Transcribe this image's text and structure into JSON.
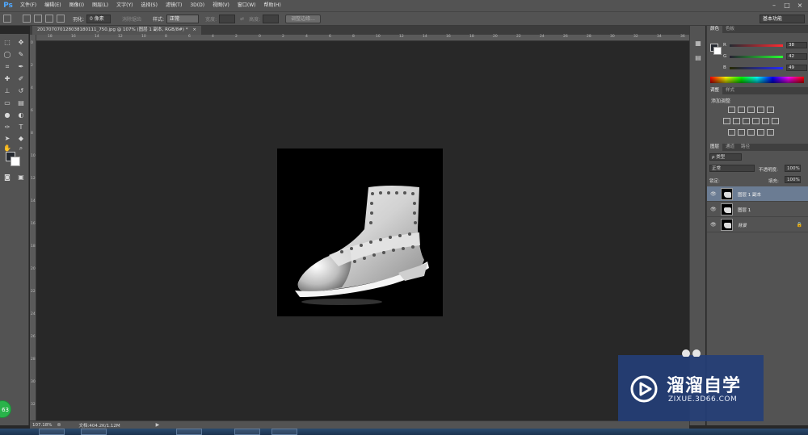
{
  "app": {
    "logo": "Ps",
    "menu": [
      "文件(F)",
      "编辑(E)",
      "图像(I)",
      "图层(L)",
      "文字(Y)",
      "选择(S)",
      "滤镜(T)",
      "3D(D)",
      "视图(V)",
      "窗口(W)",
      "帮助(H)"
    ],
    "window_buttons": [
      "–",
      "□",
      "×"
    ]
  },
  "options_bar": {
    "feather_label": "羽化:",
    "feather_value": "0 像素",
    "antialias_label": "消除锯齿",
    "style_label": "样式:",
    "style_value": "正常",
    "width_label": "宽度:",
    "height_label": "高度:",
    "refine_edge_button": "调整边缘...",
    "workspace": "基本功能"
  },
  "document": {
    "tab_title": "201707070128038180111_750.jpg @ 107% (图层 1 副本, RGB/8#) *",
    "close_icon": "×"
  },
  "rulers": {
    "top_ticks": [
      "18",
      "16",
      "14",
      "12",
      "10",
      "8",
      "6",
      "4",
      "2",
      "0",
      "2",
      "4",
      "6",
      "8",
      "10",
      "12",
      "14",
      "16",
      "18",
      "20",
      "22",
      "24",
      "26",
      "28",
      "30",
      "32",
      "34",
      "36"
    ],
    "left_ticks": [
      "0",
      "2",
      "4",
      "6",
      "8",
      "10",
      "12",
      "14",
      "16",
      "18",
      "20",
      "22",
      "24",
      "26",
      "28",
      "30",
      "32"
    ]
  },
  "status_bar": {
    "zoom": "107.18%",
    "doc_size": "文档:404.2K/1.12M"
  },
  "color_panel": {
    "tabs": [
      "颜色",
      "色板"
    ],
    "channels": [
      {
        "name": "R",
        "value": "38",
        "color": "#ff3030"
      },
      {
        "name": "G",
        "value": "42",
        "color": "#30c030"
      },
      {
        "name": "B",
        "value": "49",
        "color": "#3050ff"
      }
    ]
  },
  "adjustments_panel": {
    "tabs": [
      "调整",
      "样式"
    ],
    "heading": "添加调整"
  },
  "layers_panel": {
    "tabs": [
      "图层",
      "通道",
      "路径"
    ],
    "kind_filter": "ρ 类型",
    "blend_mode": "正常",
    "opacity_label": "不透明度:",
    "opacity_value": "100%",
    "lock_label": "锁定:",
    "fill_label": "填充:",
    "fill_value": "100%",
    "layers": [
      {
        "name": "图层 1 副本",
        "selected": true,
        "italic": false
      },
      {
        "name": "图层 1",
        "selected": false,
        "italic": false
      },
      {
        "name": "背景",
        "selected": false,
        "italic": true
      }
    ]
  },
  "watermark": {
    "title": "溜溜自学",
    "url": "ZIXUE.3D66.COM"
  },
  "badge": "63"
}
